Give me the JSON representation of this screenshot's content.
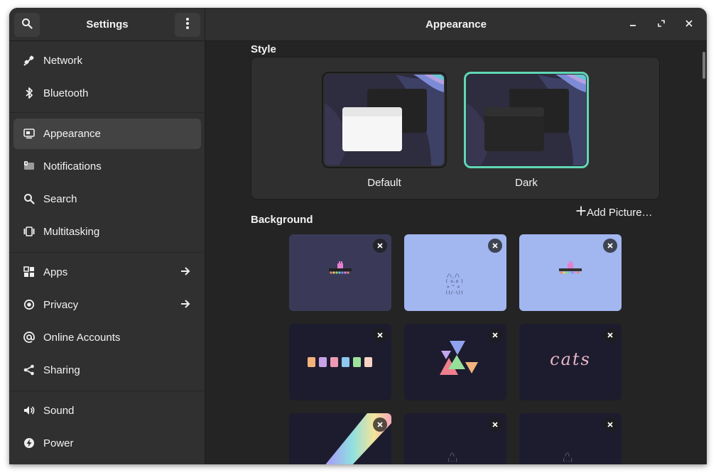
{
  "sidebar": {
    "title": "Settings",
    "search_icon": "search-icon",
    "menu_icon": "vertical-dots-icon",
    "items": [
      {
        "label": "Network",
        "icon": "network-icon",
        "arrow": false,
        "active": false
      },
      {
        "label": "Bluetooth",
        "icon": "bluetooth-icon",
        "arrow": false,
        "active": false
      },
      {
        "label": "Appearance",
        "icon": "appearance-icon",
        "arrow": false,
        "active": true
      },
      {
        "label": "Notifications",
        "icon": "notifications-icon",
        "arrow": false,
        "active": false
      },
      {
        "label": "Search",
        "icon": "search-icon",
        "arrow": false,
        "active": false
      },
      {
        "label": "Multitasking",
        "icon": "multitasking-icon",
        "arrow": false,
        "active": false
      },
      {
        "label": "Apps",
        "icon": "apps-icon",
        "arrow": true,
        "active": false
      },
      {
        "label": "Privacy",
        "icon": "privacy-icon",
        "arrow": true,
        "active": false
      },
      {
        "label": "Online Accounts",
        "icon": "online-accounts-icon",
        "arrow": false,
        "active": false
      },
      {
        "label": "Sharing",
        "icon": "sharing-icon",
        "arrow": false,
        "active": false
      },
      {
        "label": "Sound",
        "icon": "sound-icon",
        "arrow": false,
        "active": false
      },
      {
        "label": "Power",
        "icon": "power-icon",
        "arrow": false,
        "active": false
      }
    ]
  },
  "main": {
    "title": "Appearance",
    "style": {
      "section_title": "Style",
      "options": [
        {
          "label": "Default",
          "selected": false
        },
        {
          "label": "Dark",
          "selected": true
        }
      ]
    },
    "background": {
      "section_title": "Background",
      "add_picture_label": "Add Picture…",
      "wallpapers": [
        {
          "name": "pixel-cat-train-dark"
        },
        {
          "name": "ascii-cat-light"
        },
        {
          "name": "pixel-cat-train-light"
        },
        {
          "name": "pastel-blocks"
        },
        {
          "name": "pastel-triangles"
        },
        {
          "name": "cats-text"
        },
        {
          "name": "rainbow-stripe"
        },
        {
          "name": "ascii-cat-dark-1"
        },
        {
          "name": "ascii-cat-dark-2"
        }
      ],
      "text_art": {
        "cats": "cats",
        "ascii_cat": "/\\_/\\\n( o.o )\n > ^ <",
        "ascii_small": "/\\\n(..)"
      }
    }
  },
  "colors": {
    "accent": "#5fd7b8",
    "window_bg": "#242424",
    "sidebar_bg": "#303030",
    "active_item": "#434343"
  }
}
